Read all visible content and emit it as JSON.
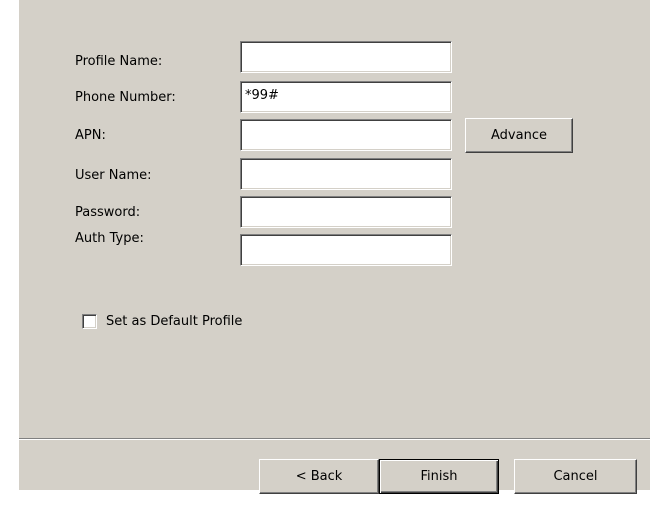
{
  "form": {
    "fields": [
      {
        "label": "Profile Name:",
        "value": ""
      },
      {
        "label": "Phone Number:",
        "value": "*99#"
      },
      {
        "label": "APN:",
        "value": ""
      },
      {
        "label": "User Name:",
        "value": ""
      },
      {
        "label": "Password:",
        "value": ""
      },
      {
        "label": "Auth Type:",
        "value": ""
      }
    ],
    "advance_label": "Advance",
    "default_profile_label": "Set as Default Profile",
    "default_profile_checked": false
  },
  "footer": {
    "back_label": "< Back",
    "finish_label": "Finish",
    "cancel_label": "Cancel"
  }
}
